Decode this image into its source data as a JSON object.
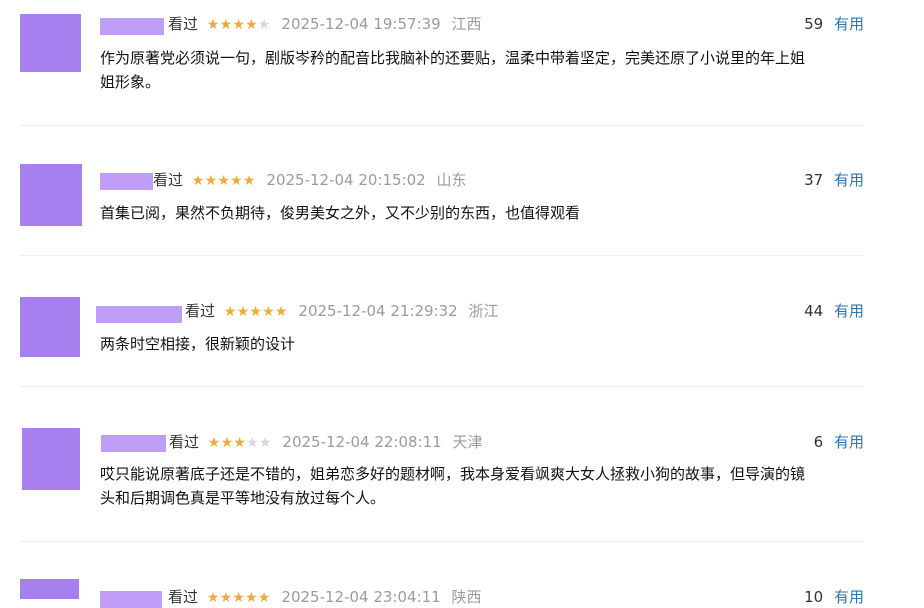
{
  "seen_label": "看过",
  "useful_label": "有用",
  "colors": {
    "star_on": "#f0a93a",
    "star_off": "#d7d7d7",
    "link": "#2b76b5",
    "avatar_placeholder": "#a780f0"
  },
  "comments": [
    {
      "rating": 4,
      "time": "2025-12-04 19:57:39",
      "location": "江西",
      "votes": "59",
      "text_lines": [
        "作为原著党必须说一句，剧版岑矜的配音比我脑补的还要贴，温柔中带着坚定，完美还原了小说里的年上姐",
        "姐形象。"
      ]
    },
    {
      "rating": 5,
      "time": "2025-12-04 20:15:02",
      "location": "山东",
      "votes": "37",
      "text_lines": [
        "首集已阅，果然不负期待，俊男美女之外，又不少别的东西，也值得观看"
      ]
    },
    {
      "rating": 5,
      "time": "2025-12-04 21:29:32",
      "location": "浙江",
      "votes": "44",
      "text_lines": [
        "两条时空相接，很新颖的设计"
      ]
    },
    {
      "rating": 3,
      "time": "2025-12-04 22:08:11",
      "location": "天津",
      "votes": "6",
      "text_lines": [
        "哎只能说原著底子还是不错的，姐弟恋多好的题材啊，我本身爱看飒爽大女人拯救小狗的故事，但导演的镜",
        "头和后期调色真是平等地没有放过每个人。"
      ]
    },
    {
      "rating": 5,
      "time": "2025-12-04 23:04:11",
      "location": "陕西",
      "votes": "10",
      "text_lines": []
    }
  ]
}
